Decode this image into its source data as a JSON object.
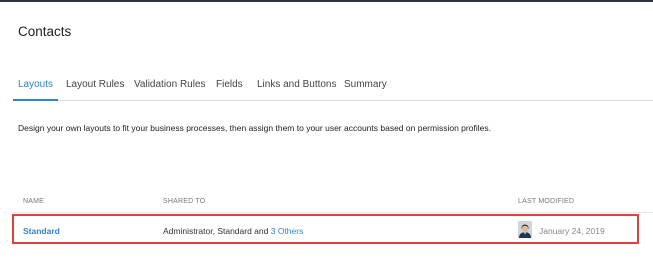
{
  "page": {
    "title": "Contacts"
  },
  "tabs": [
    {
      "label": "Layouts",
      "active": true
    },
    {
      "label": "Layout Rules",
      "active": false
    },
    {
      "label": "Validation Rules",
      "active": false
    },
    {
      "label": "Fields",
      "active": false
    },
    {
      "label": "Links and Buttons",
      "active": false
    },
    {
      "label": "Summary",
      "active": false
    }
  ],
  "description": "Design your own layouts to fit your business processes, then assign them to your user accounts based on permission profiles.",
  "table": {
    "columns": {
      "name": "NAME",
      "shared_to": "SHARED TO",
      "last_modified": "LAST MODIFIED"
    },
    "rows": [
      {
        "name": "Standard",
        "shared_prefix": "Administrator, Standard and",
        "shared_link": "3 Others",
        "modified_date": "January 24, 2019",
        "avatar_icon": "user-avatar-icon"
      }
    ]
  },
  "colors": {
    "accent": "#2f86c8",
    "highlight": "#e2403b"
  }
}
